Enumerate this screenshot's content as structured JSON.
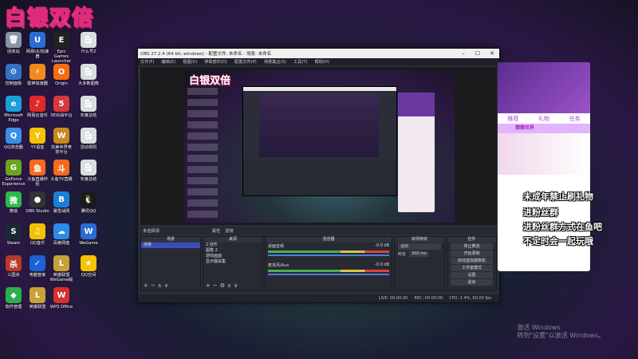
{
  "stamp": "白银双倍",
  "desktop": [
    {
      "label": "回收站",
      "color": "#8a93a3",
      "glyph": "🗑"
    },
    {
      "label": "网易UU加速器",
      "color": "#2a6bd6",
      "glyph": "U"
    },
    {
      "label": "Epic Games Launcher",
      "color": "#222",
      "glyph": "E"
    },
    {
      "label": "什么号2",
      "color": "#ddd",
      "glyph": "📄"
    },
    {
      "label": "控制面板",
      "color": "#3470c6",
      "glyph": "⚙"
    },
    {
      "label": "雷神加速器",
      "color": "#f08a1c",
      "glyph": "⚡"
    },
    {
      "label": "Origin",
      "color": "#f56c12",
      "glyph": "O"
    },
    {
      "label": "大多数图像",
      "color": "#ddd",
      "glyph": "📄"
    },
    {
      "label": "Microsoft Edge",
      "color": "#1a9fd9",
      "glyph": "e"
    },
    {
      "label": "网易云音乐",
      "color": "#e02a2a",
      "glyph": "♪"
    },
    {
      "label": "5E对战平台",
      "color": "#d63a3a",
      "glyph": "5"
    },
    {
      "label": "年度总结",
      "color": "#ddd",
      "glyph": "📄"
    },
    {
      "label": "QQ浏览器",
      "color": "#3b8ee8",
      "glyph": "Q"
    },
    {
      "label": "YY语音",
      "color": "#f5c400",
      "glyph": "Y"
    },
    {
      "label": "完美世界竞技平台",
      "color": "#c8891e",
      "glyph": "W"
    },
    {
      "label": "活动规则",
      "color": "#ddd",
      "glyph": "📄"
    },
    {
      "label": "GeForce Experience",
      "color": "#6aa51e",
      "glyph": "G"
    },
    {
      "label": "斗鱼直播伴侣",
      "color": "#f56a1c",
      "glyph": "鱼"
    },
    {
      "label": "斗鱼TV直播",
      "color": "#f56a1c",
      "glyph": "斗"
    },
    {
      "label": "年度总结",
      "color": "#ddd",
      "glyph": "📄"
    },
    {
      "label": "微信",
      "color": "#2bbb4a",
      "glyph": "微"
    },
    {
      "label": "OBS Studio",
      "color": "#333",
      "glyph": "●"
    },
    {
      "label": "暴雪战网",
      "color": "#1a7fd6",
      "glyph": "B"
    },
    {
      "label": "腾讯QQ",
      "color": "#1a1a1a",
      "glyph": "🐧"
    },
    {
      "label": "Steam",
      "color": "#1b2838",
      "glyph": "S"
    },
    {
      "label": "QQ音乐",
      "color": "#f2c200",
      "glyph": "♫"
    },
    {
      "label": "百度网盘",
      "color": "#2a8be8",
      "glyph": "☁"
    },
    {
      "label": "WeGame",
      "color": "#2a6bd6",
      "glyph": "W"
    },
    {
      "label": "三国杀",
      "color": "#b83a2a",
      "glyph": "杀"
    },
    {
      "label": "电脑管家",
      "color": "#1a62d6",
      "glyph": "✓"
    },
    {
      "label": "英雄联盟WeGame版",
      "color": "#c8a23a",
      "glyph": "L"
    },
    {
      "label": "QQ空间",
      "color": "#f5c400",
      "glyph": "★"
    },
    {
      "label": "软件管理",
      "color": "#2ab04a",
      "glyph": "◆"
    },
    {
      "label": "英雄联盟",
      "color": "#c8a23a",
      "glyph": "L"
    },
    {
      "label": "WPS Office",
      "color": "#d6302a",
      "glyph": "W"
    }
  ],
  "obs": {
    "title": "OBS 27.2.4 (64 bit, windows) - 配置文件: 未命名 - 场景: 未命名",
    "menu": [
      "文件(F)",
      "编辑(E)",
      "视图(V)",
      "停靠部件(D)",
      "配置文件(P)",
      "场景集合(S)",
      "工具(T)",
      "帮助(H)"
    ],
    "preview_stamp": "白银双倍",
    "scene_bar": [
      "未选择源",
      "属性",
      "滤镜"
    ],
    "docks": {
      "scenes": {
        "title": "场景",
        "items": [
          "场景"
        ]
      },
      "sources": {
        "title": "来源",
        "items": [
          "2.挂件",
          "图像 2",
          "游戏画面",
          "显示器采集"
        ]
      },
      "mixer": {
        "title": "混音器",
        "tracks": [
          {
            "name": "桌面音频",
            "db": "-0.0 dB"
          },
          {
            "name": "麦克风/Aux",
            "db": "-0.0 dB"
          }
        ]
      },
      "transitions": {
        "title": "转场特效",
        "type": "淡出",
        "duration_label": "时长",
        "duration": "300 ms"
      },
      "controls": {
        "title": "控件",
        "buttons": [
          "停止推流",
          "开始录制",
          "启动虚拟摄像机",
          "工作室模式",
          "设置",
          "退出"
        ]
      }
    },
    "status": [
      "LIVE: 00:00:00",
      "REC: 00:00:00",
      "CPU: 2.4%, 60.00 fps"
    ]
  },
  "chat": {
    "tabs": [
      "推荐",
      "礼物",
      "任务"
    ],
    "banner": "猜猜世界"
  },
  "overlay": [
    "未成年禁止刷礼物",
    "进粉丝群",
    "进粉丝群方式在鱼吧",
    "不定时会一起玩哦"
  ],
  "watermark": [
    "激活 Windows",
    "转到\"设置\"以激活 Windows。"
  ]
}
